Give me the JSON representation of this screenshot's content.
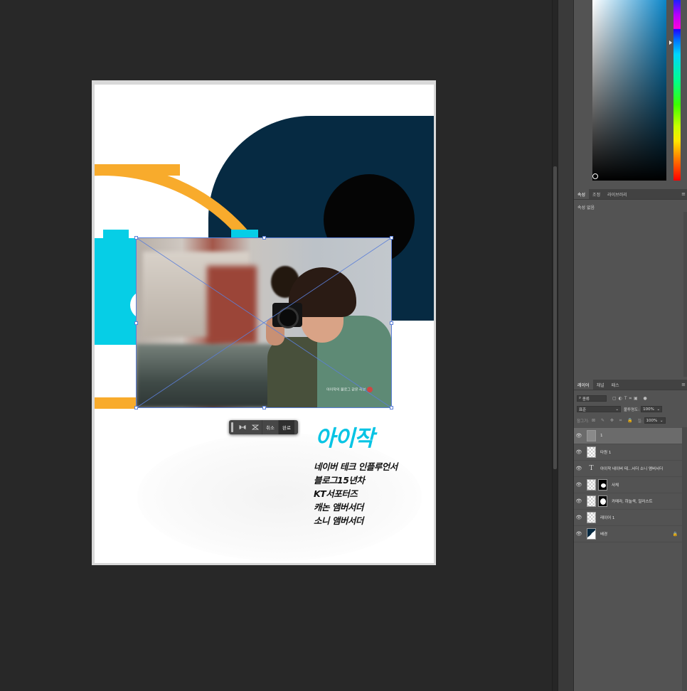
{
  "document": {
    "title": "아이작",
    "lines": [
      "네이버 테크 인플루언서",
      "블로그15년차",
      "KT서포터즈",
      "캐논 앰버서더",
      "소니 앰버서더"
    ],
    "photo_watermark": "아이작의 블로그 같은 리뷰",
    "colors": {
      "navy": "#062a42",
      "orange": "#f8ab2c",
      "cyan": "#06cee6",
      "title": "#06c4e4"
    }
  },
  "transform_bar": {
    "warp_icon": "warp-icon",
    "flip_icon": "flip-icon",
    "cancel_label": "취소",
    "done_label": "완료"
  },
  "properties_panel": {
    "tabs": [
      "속성",
      "조정",
      "라이브러리"
    ],
    "empty_label": "속성 없음"
  },
  "layers_panel": {
    "tabs": [
      "레이어",
      "채널",
      "패스"
    ],
    "search_placeholder": "종류",
    "blend_mode": "표준",
    "opacity_label": "불투명도:",
    "opacity_value": "100%",
    "lock_label": "잠그기:",
    "fill_label": "칠:",
    "fill_value": "100%",
    "layers": [
      {
        "name": "1",
        "type": "image",
        "selected": true
      },
      {
        "name": "타원 1",
        "type": "shape"
      },
      {
        "name": "아이작 네이버 테...서더 소니 앰버서더",
        "type": "text"
      },
      {
        "name": "사체",
        "type": "masked"
      },
      {
        "name": "카메라, 하늘색, 일러스트",
        "type": "masked"
      },
      {
        "name": "레이어 1",
        "type": "empty"
      },
      {
        "name": "배경",
        "type": "background",
        "locked": true
      }
    ]
  }
}
